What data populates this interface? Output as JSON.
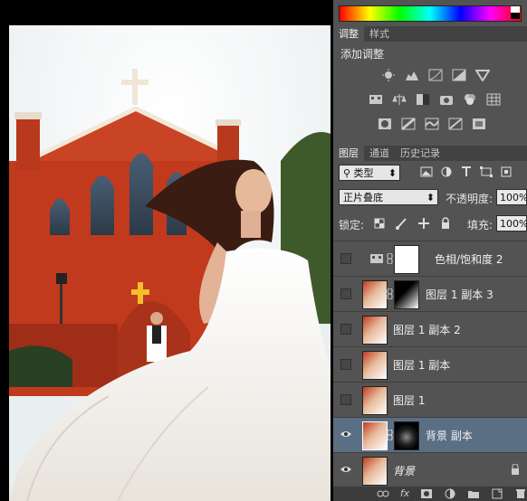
{
  "adjustments_panel": {
    "tab_adjust": "调整",
    "tab_style": "样式",
    "heading": "添加调整"
  },
  "layers_panel": {
    "tab_layers": "图层",
    "tab_channels": "通道",
    "tab_history": "历史记录",
    "filter_type": "类型",
    "blend_mode": "正片叠底",
    "opacity_label": "不透明度:",
    "opacity_value": "100%",
    "lock_label": "锁定:",
    "fill_label": "填充:",
    "fill_value": "100%",
    "layers": [
      {
        "name": "色相/饱和度 2",
        "visible": false
      },
      {
        "name": "图层 1 副本 3",
        "visible": false
      },
      {
        "name": "图层 1 副本 2",
        "visible": false
      },
      {
        "name": "图层 1 副本",
        "visible": false
      },
      {
        "name": "图层 1",
        "visible": false
      },
      {
        "name": "背景 副本",
        "visible": true,
        "selected": true
      },
      {
        "name": "背景",
        "visible": true
      }
    ],
    "footer_icons": [
      "link-icon",
      "fx-icon",
      "mask-icon",
      "adjustment-icon",
      "folder-icon",
      "new-layer-icon",
      "trash-icon"
    ]
  },
  "colors": {
    "panel_bg": "#535353",
    "selected_layer": "#5b6f84",
    "brick": "#c13a1d"
  }
}
